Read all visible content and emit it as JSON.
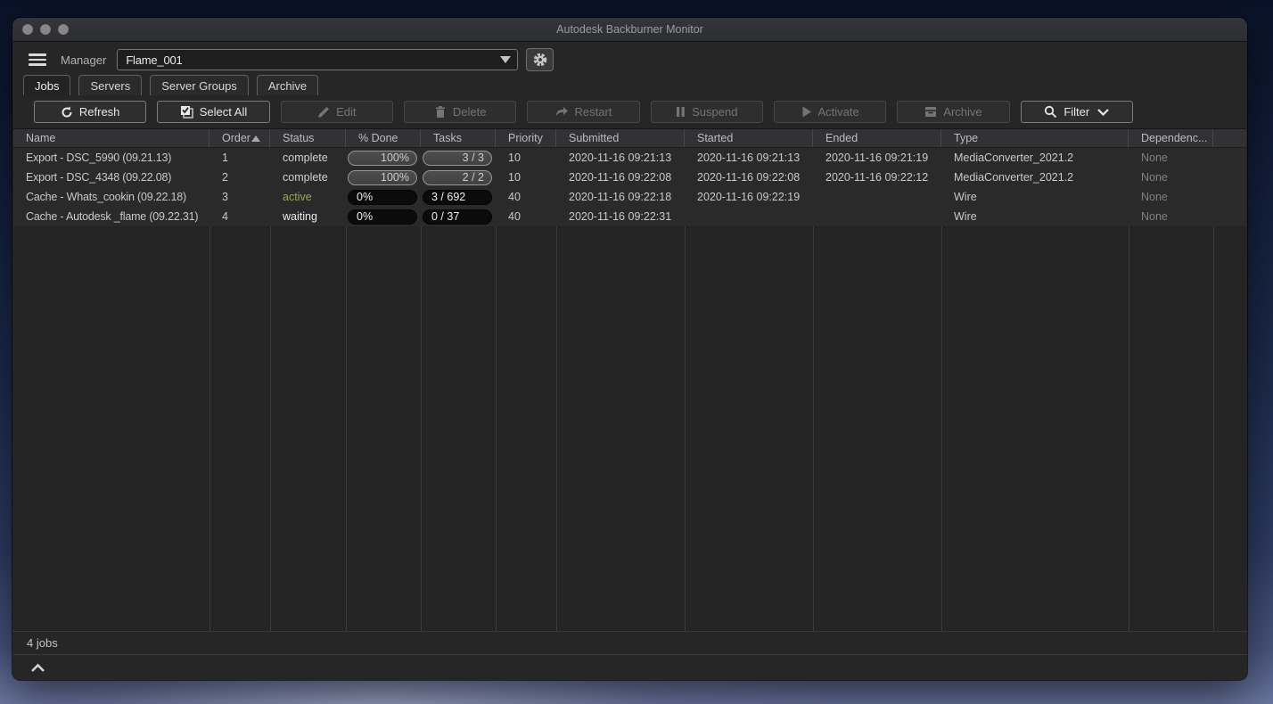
{
  "window": {
    "title": "Autodesk Backburner Monitor"
  },
  "menu": {
    "manager_label": "Manager",
    "manager_value": "Flame_001"
  },
  "tabs": [
    {
      "label": "Jobs"
    },
    {
      "label": "Servers"
    },
    {
      "label": "Server Groups"
    },
    {
      "label": "Archive"
    }
  ],
  "toolbar": {
    "buttons": [
      {
        "label": "Refresh",
        "enabled": true
      },
      {
        "label": "Select All",
        "enabled": true
      },
      {
        "label": "Edit",
        "enabled": false
      },
      {
        "label": "Delete",
        "enabled": false
      },
      {
        "label": "Restart",
        "enabled": false
      },
      {
        "label": "Suspend",
        "enabled": false
      },
      {
        "label": "Activate",
        "enabled": false
      },
      {
        "label": "Archive",
        "enabled": false
      },
      {
        "label": "Filter",
        "enabled": true
      }
    ]
  },
  "table": {
    "columns": [
      {
        "label": "Name"
      },
      {
        "label": "Order",
        "sort": "asc"
      },
      {
        "label": "Status"
      },
      {
        "label": "% Done"
      },
      {
        "label": "Tasks"
      },
      {
        "label": "Priority"
      },
      {
        "label": "Submitted"
      },
      {
        "label": "Started"
      },
      {
        "label": "Ended"
      },
      {
        "label": "Type"
      },
      {
        "label": "Dependenc..."
      }
    ],
    "rows": [
      {
        "name": "Export - DSC_5990 (09.21.13)",
        "order": "1",
        "status": "complete",
        "done": "100%",
        "tasks": "3 / 3",
        "priority": "10",
        "submitted": "2020-11-16 09:21:13",
        "started": "2020-11-16 09:21:13",
        "ended": "2020-11-16 09:21:19",
        "type": "MediaConverter_2021.2",
        "dependencies": "None"
      },
      {
        "name": "Export - DSC_4348 (09.22.08)",
        "order": "2",
        "status": "complete",
        "done": "100%",
        "tasks": "2 / 2",
        "priority": "10",
        "submitted": "2020-11-16 09:22:08",
        "started": "2020-11-16 09:22:08",
        "ended": "2020-11-16 09:22:12",
        "type": "MediaConverter_2021.2",
        "dependencies": "None"
      },
      {
        "name": "Cache - Whats_cookin (09.22.18)",
        "order": "3",
        "status": "active",
        "done": "0%",
        "tasks": "3 / 692",
        "priority": "40",
        "submitted": "2020-11-16 09:22:18",
        "started": "2020-11-16 09:22:19",
        "ended": "",
        "type": "Wire",
        "dependencies": "None"
      },
      {
        "name": "Cache - Autodesk _flame (09.22.31)",
        "order": "4",
        "status": "waiting",
        "done": "0%",
        "tasks": "0 / 37",
        "priority": "40",
        "submitted": "2020-11-16 09:22:31",
        "started": "",
        "ended": "",
        "type": "Wire",
        "dependencies": "None"
      }
    ]
  },
  "status_bar": {
    "jobs_count_text": "4 jobs"
  },
  "colors": {
    "active_status": "#95a94f",
    "window_bg": "#262626",
    "header_bg": "#323236"
  }
}
